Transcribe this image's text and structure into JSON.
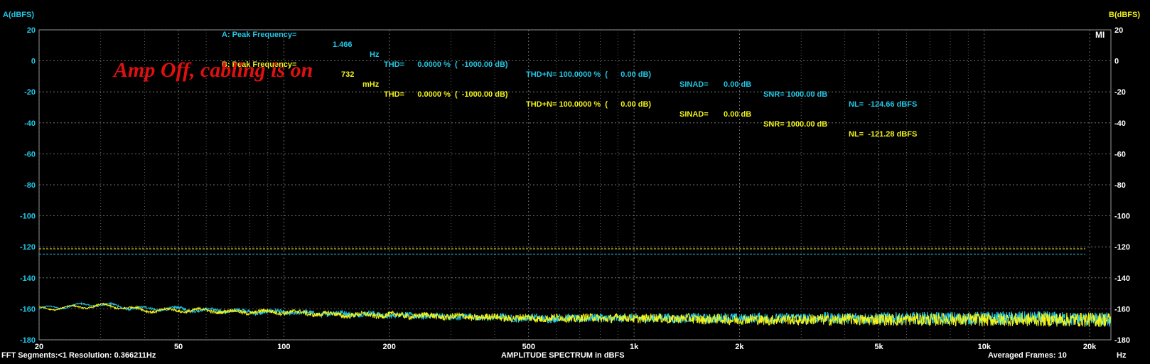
{
  "header": {
    "a": {
      "label": "A: Peak Frequency=",
      "peak_value": "1.466",
      "peak_unit": "Hz",
      "thd": "THD=      0.0000 %  (  -1000.00 dB)",
      "thdn": "THD+N= 100.0000 %  (      0.00 dB)",
      "sinad": "SINAD=       0.00 dB",
      "snr": "SNR= 1000.00 dB",
      "nl": "NL=  -124.66 dBFS"
    },
    "b": {
      "label": "B: Peak Frequency=",
      "peak_value": "732",
      "peak_unit": "mHz",
      "thd": "THD=      0.0000 %  (  -1000.00 dB)",
      "thdn": "THD+N= 100.0000 %  (      0.00 dB)",
      "sinad": "SINAD=       0.00 dB",
      "snr": "SNR= 1000.00 dB",
      "nl": "NL=  -121.28 dBFS"
    }
  },
  "annotation": "Amp Off, cabling is on",
  "corner_mark": "MI",
  "footer": {
    "left": "FFT Segments:<1    Resolution: 0.366211Hz",
    "center": "AMPLITUDE SPECTRUM in dBFS",
    "right": "Averaged Frames: 10",
    "xunit": "Hz"
  },
  "chart_data": {
    "type": "line",
    "title": "AMPLITUDE SPECTRUM in dBFS",
    "xlabel": "Hz",
    "ylabel_left": "A(dBFS)",
    "ylabel_right": "B(dBFS)",
    "xscale": "log",
    "xlim": [
      20,
      23000
    ],
    "ylim": [
      -180,
      20
    ],
    "grid": true,
    "x_ticks": [
      20,
      50,
      100,
      200,
      500,
      1000,
      2000,
      5000,
      10000,
      20000
    ],
    "x_tick_labels": [
      "20",
      "50",
      "100",
      "200",
      "500",
      "1k",
      "2k",
      "5k",
      "10k",
      "20k"
    ],
    "y_ticks": [
      20,
      0,
      -20,
      -40,
      -60,
      -80,
      -100,
      -120,
      -140,
      -160,
      -180
    ],
    "y_tick_labels": [
      "20",
      "0",
      "-20",
      "-40",
      "-60",
      "-80",
      "-100",
      "-120",
      "-140",
      "-160",
      "-180"
    ],
    "colors": {
      "a": "#22c8e6",
      "b": "#f2f21a",
      "grid": "#8a8a8a",
      "annotation": "#e01010"
    },
    "reference_lines": [
      {
        "series": "A",
        "y": -124.66,
        "style": "dashed"
      },
      {
        "series": "B",
        "y": -121.28,
        "style": "dashed"
      }
    ],
    "series": [
      {
        "name": "A",
        "x": [
          20,
          25,
          30,
          35,
          40,
          50,
          60,
          70,
          80,
          100,
          120,
          150,
          200,
          300,
          500,
          700,
          1000,
          2000,
          3000,
          5000,
          7000,
          10000,
          15000,
          20000,
          23000
        ],
        "y": [
          -160,
          -158,
          -157,
          -159,
          -160,
          -160,
          -161,
          -161,
          -162,
          -162,
          -163,
          -163,
          -164,
          -165,
          -166,
          -166,
          -166,
          -166,
          -166,
          -166,
          -166,
          -166,
          -166,
          -167,
          -167
        ]
      },
      {
        "name": "B",
        "x": [
          20,
          25,
          30,
          35,
          40,
          50,
          60,
          70,
          80,
          100,
          120,
          150,
          200,
          300,
          500,
          700,
          1000,
          2000,
          3000,
          5000,
          7000,
          10000,
          15000,
          20000,
          23000
        ],
        "y": [
          -160,
          -159,
          -158,
          -159,
          -161,
          -161,
          -161,
          -162,
          -162,
          -162,
          -163,
          -164,
          -164,
          -165,
          -166,
          -166,
          -166,
          -167,
          -167,
          -167,
          -167,
          -167,
          -167,
          -167,
          -167
        ]
      }
    ]
  }
}
